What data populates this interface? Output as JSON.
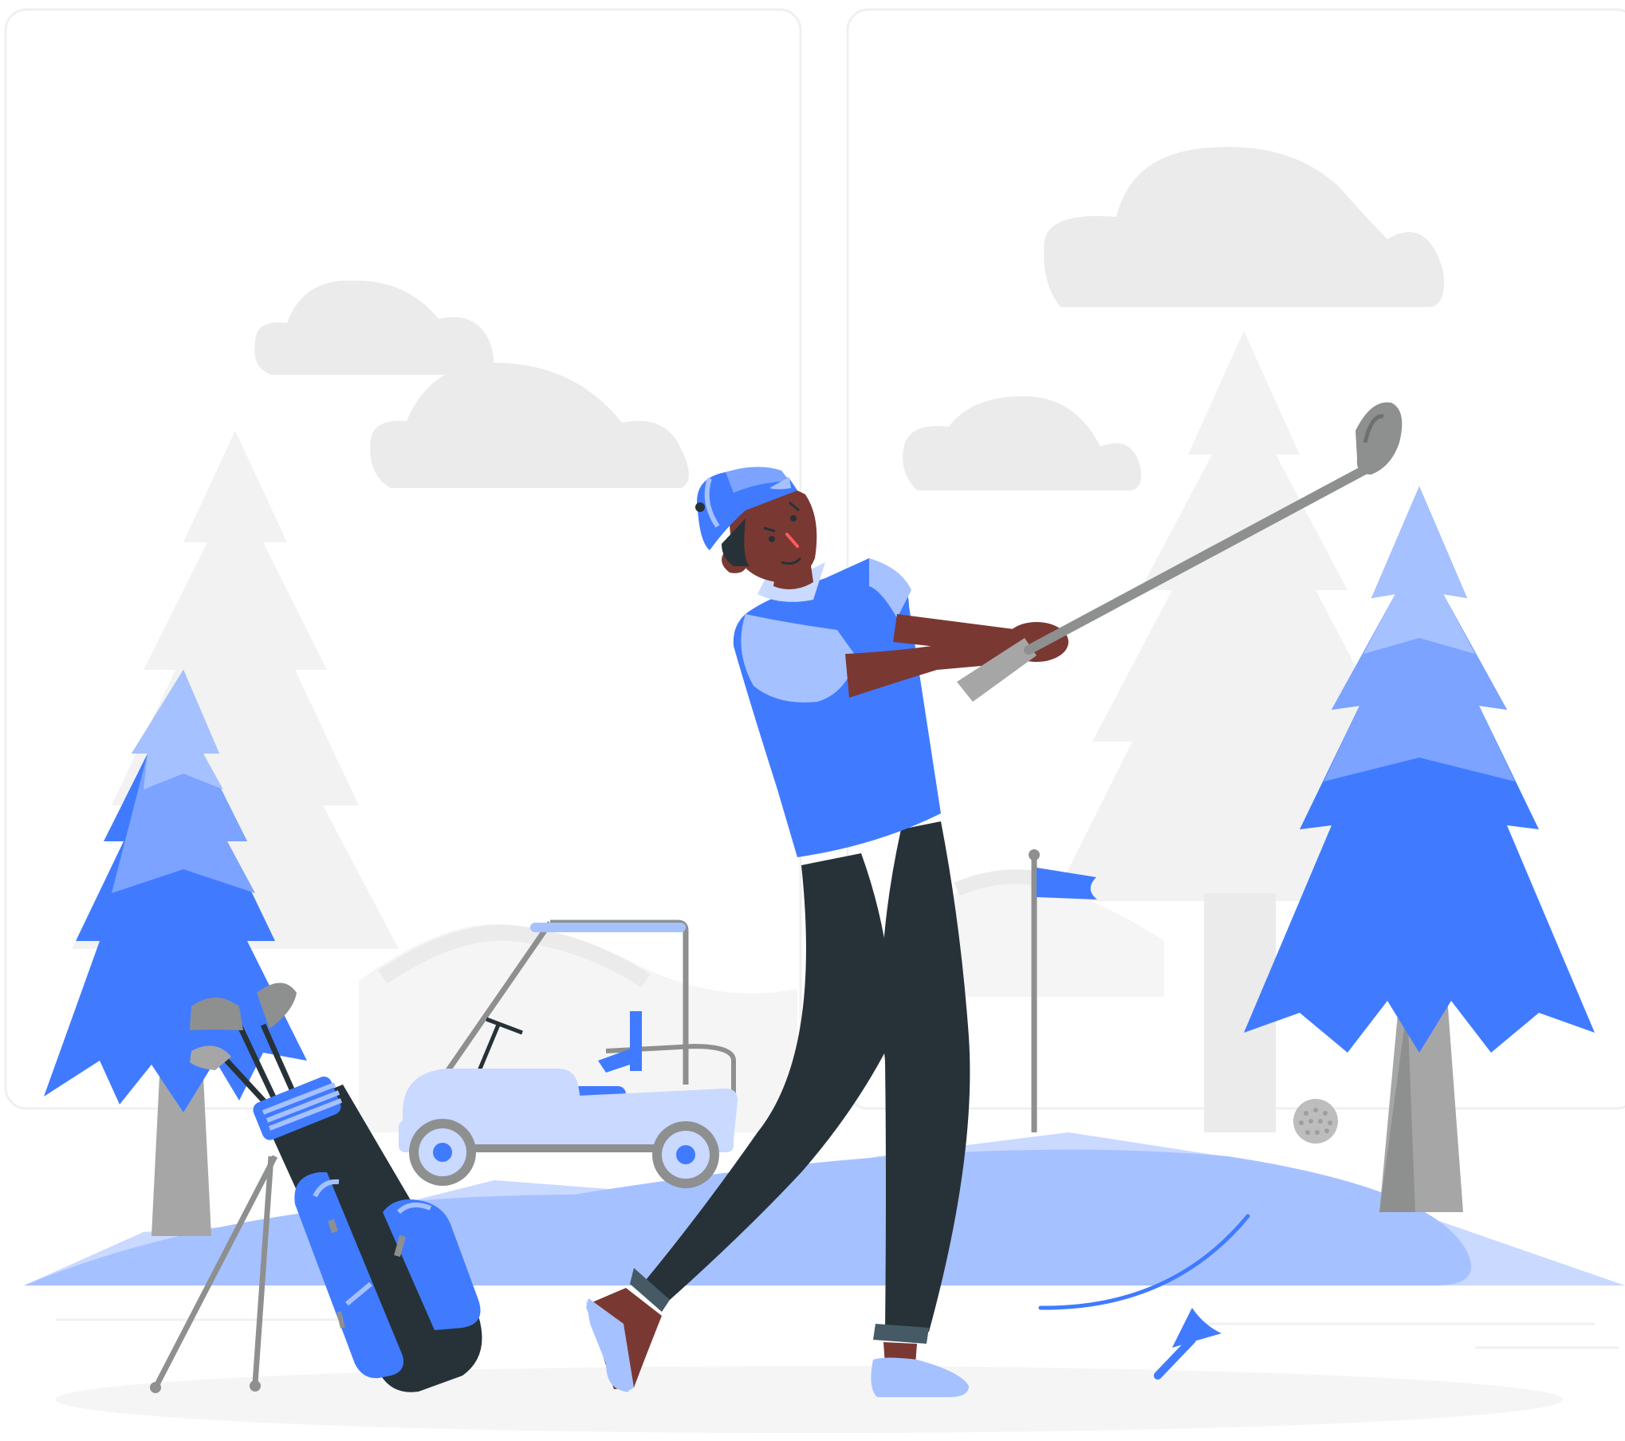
{
  "illustration": {
    "subject": "golfer-swinging-club",
    "colors": {
      "primary_blue": "#407BFF",
      "mid_blue": "#7BA3FF",
      "light_blue": "#A6C1FF",
      "pale_blue": "#C9D9FF",
      "dark_navy": "#263238",
      "skin": "#7A3833",
      "club_grey": "#8E9090",
      "light_grey": "#EBEBEB",
      "panel_grey": "#F5F5F5",
      "trunk_grey": "#A6A6A6"
    },
    "icons": [
      "cloud-icon",
      "pine-tree-icon",
      "golf-cart-icon",
      "golf-flag-icon",
      "golf-ball-icon",
      "golf-tee-icon",
      "golf-bag-icon",
      "golf-club-icon"
    ]
  }
}
